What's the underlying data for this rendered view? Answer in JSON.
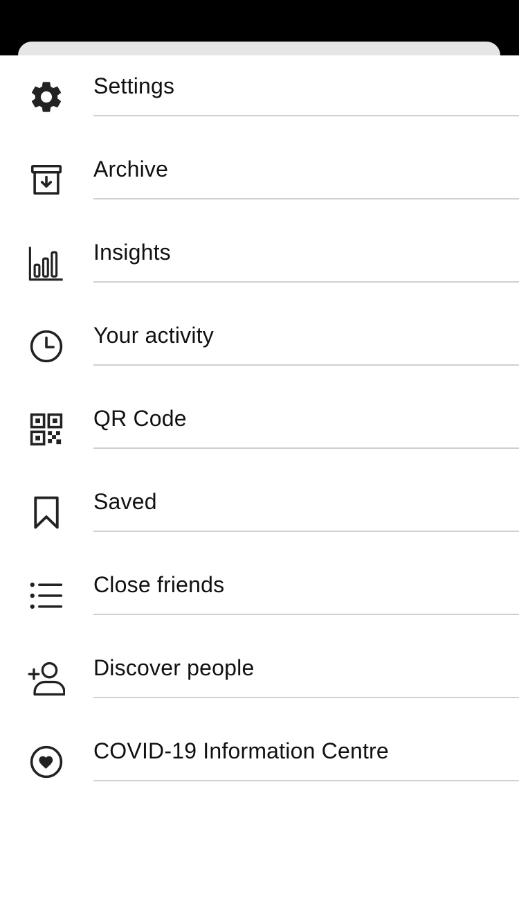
{
  "menu": {
    "items": [
      {
        "label": "Settings",
        "icon": "gear-icon"
      },
      {
        "label": "Archive",
        "icon": "archive-icon"
      },
      {
        "label": "Insights",
        "icon": "bar-chart-icon"
      },
      {
        "label": "Your activity",
        "icon": "clock-icon"
      },
      {
        "label": "QR Code",
        "icon": "qr-code-icon"
      },
      {
        "label": "Saved",
        "icon": "bookmark-icon"
      },
      {
        "label": "Close friends",
        "icon": "list-icon"
      },
      {
        "label": "Discover people",
        "icon": "add-person-icon"
      },
      {
        "label": "COVID-19 Information Centre",
        "icon": "heart-circle-icon"
      }
    ]
  },
  "colors": {
    "status_bar": "#000000",
    "sheet_background": "#ffffff",
    "text": "#111111",
    "divider": "#d0d0d0",
    "icon": "#222222"
  }
}
